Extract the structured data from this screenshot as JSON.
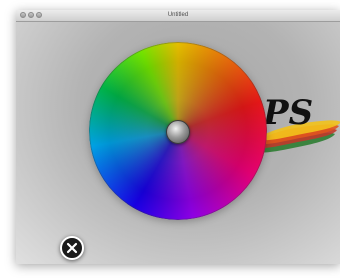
{
  "window": {
    "title": "Untitled",
    "traffic_lights": [
      "close",
      "minimize",
      "zoom"
    ]
  },
  "color_wheel": {
    "hue_stops": [
      "#ffd400",
      "#ff1a1a",
      "#ff0080",
      "#a000ff",
      "#1a00ff",
      "#00b4ff",
      "#00c850",
      "#7fff00"
    ],
    "knob": "center-knob"
  },
  "background_art": {
    "partial_text": "PS",
    "text_color": "#111111",
    "brush_stroke_colors": [
      "#f2c21b",
      "#e0541e",
      "#c0392b",
      "#2e7d32"
    ]
  },
  "close_button": {
    "icon": "close-icon"
  }
}
